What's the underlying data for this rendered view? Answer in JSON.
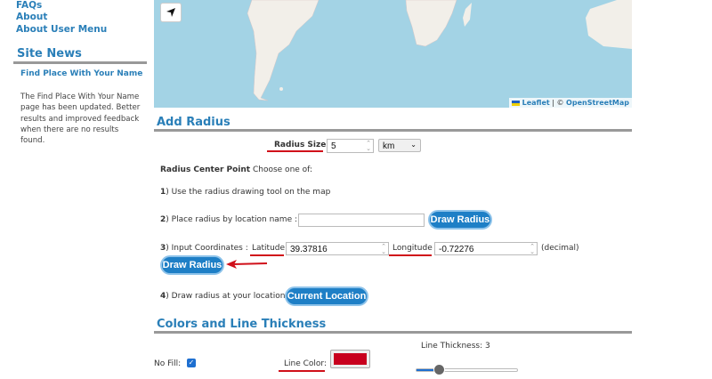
{
  "sidebar": {
    "links": [
      "FAQs",
      "About",
      "About User Menu"
    ],
    "news_heading": "Site News",
    "news_title": "Find Place With Your Name",
    "news_body": "The Find Place With Your Name page has been updated. Better results and improved feedback when there are no results found."
  },
  "map": {
    "attribution_leaflet": "Leaflet",
    "attribution_sep": " | © ",
    "attribution_osm": "OpenStreetMap",
    "locate_icon": "navigation-arrow-icon"
  },
  "add_radius": {
    "heading": "Add Radius",
    "radius_size_label": "Radius Size",
    "radius_size_value": "5",
    "unit_selected": "km",
    "center_point_label": "Radius Center Point",
    "center_point_hint": " Choose one of:",
    "option1_num": "1",
    "option1_text": ") Use the radius drawing tool on the map",
    "option2_num": "2",
    "option2_text": ") Place radius by location name :",
    "location_name_value": "",
    "draw_radius_label": "Draw Radius",
    "option3_num": "3",
    "option3_text": ") Input Coordinates :",
    "latitude_label": "Latitude",
    "latitude_value": "39.37816",
    "longitude_label": "Longitude",
    "longitude_value": "-0.72276",
    "decimal_note": "(decimal)",
    "option4_num": "4",
    "option4_text": ") Draw radius at your location",
    "current_location_label": "Current Location"
  },
  "colors": {
    "heading": "Colors and Line Thickness",
    "line_thickness_label": "Line Thickness: 3",
    "line_thickness_value": 3,
    "no_fill_label": "No Fill:",
    "no_fill_checked": true,
    "line_color_label": "Line Color:",
    "line_color": "#c8001e"
  }
}
